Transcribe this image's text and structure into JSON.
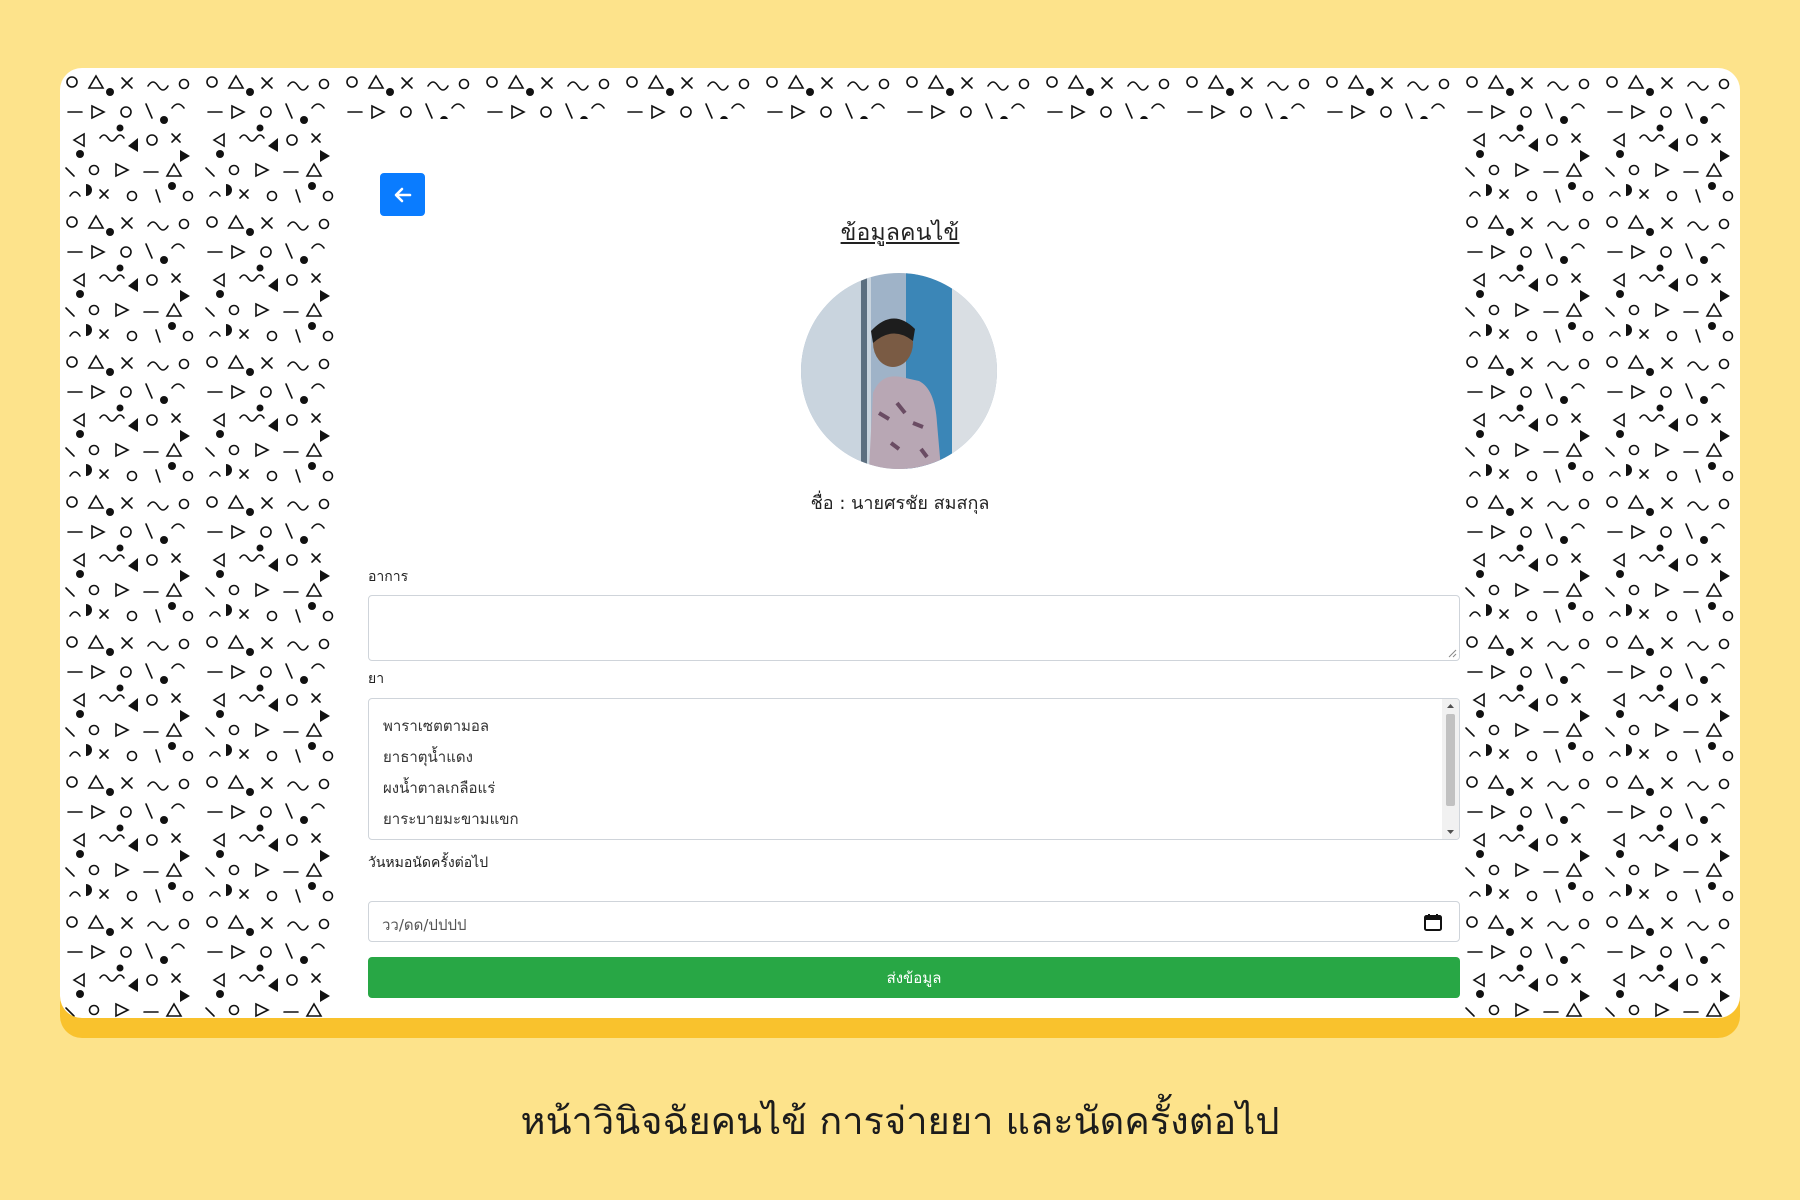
{
  "colors": {
    "page_bg": "#fde38b",
    "frame_shadow": "#f9c22d",
    "back_button": "#0a7cff",
    "submit_button": "#28a745"
  },
  "icons": {
    "back": "arrow-left-icon",
    "calendar": "calendar-icon",
    "resize": "resize-grip-icon"
  },
  "patient": {
    "title": "ข้อมูลคนไข้",
    "name_label": "ชื่อ : นายศรชัย สมสกุล"
  },
  "form": {
    "symptoms_label": "อาการ",
    "symptoms_value": "",
    "medicine_label": "ยา",
    "medicine_options": [
      "พาราเซตตามอล",
      "ยาธาตุน้ำแดง",
      "ผงน้ำตาลเกลือแร่",
      "ยาระบายมะขามแขก"
    ],
    "appointment_label": "วันหมอนัดครั้งต่อไป",
    "date_placeholder": "วว/ดด/ปปปป",
    "submit_label": "ส่งข้อมูล"
  },
  "caption": "หน้าวินิจฉัยคนไข้ การจ่ายยา และนัดครั้งต่อไป"
}
